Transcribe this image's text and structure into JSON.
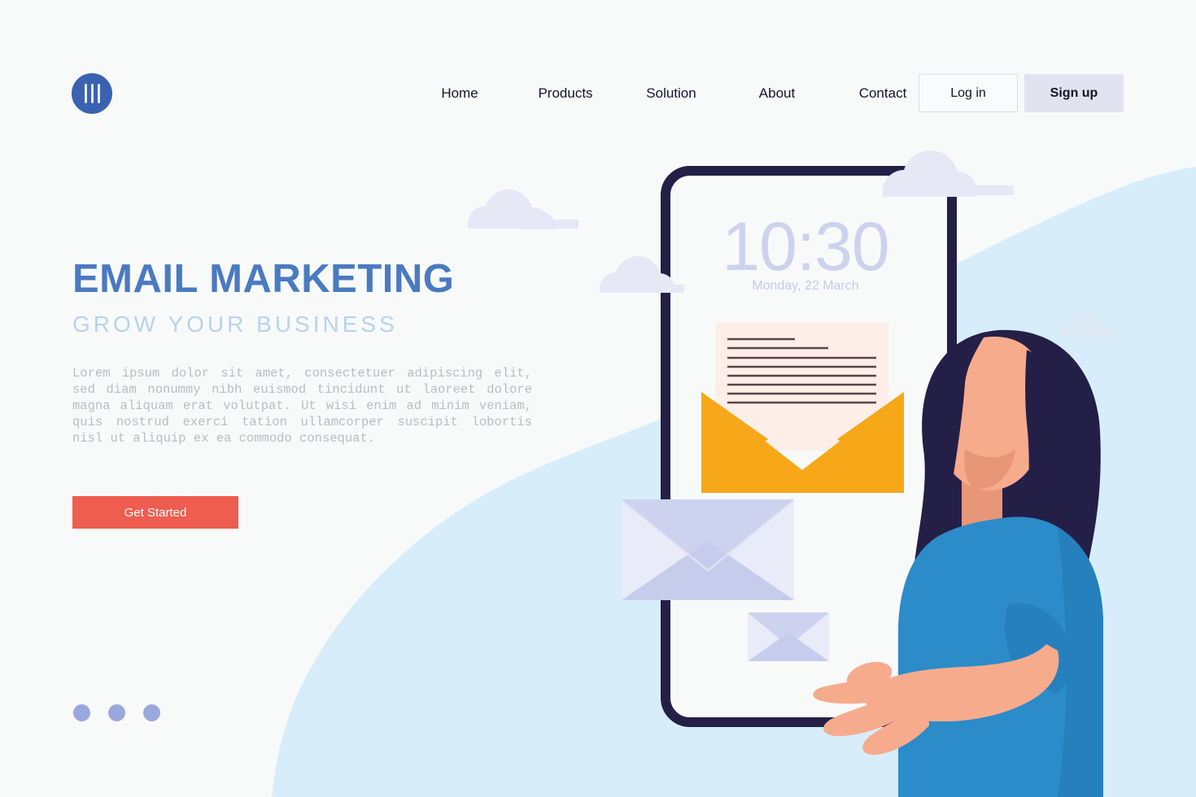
{
  "brand": {
    "logo_icon": "three-bars-circle-logo"
  },
  "nav": {
    "items": [
      {
        "label": "Home"
      },
      {
        "label": "Products"
      },
      {
        "label": "Solution"
      },
      {
        "label": "About"
      },
      {
        "label": "Contact"
      }
    ],
    "login_label": "Log in",
    "signup_label": "Sign up"
  },
  "hero": {
    "title": "EMAIL MARKETING",
    "subtitle": "GROW YOUR BUSINESS",
    "body": "Lorem ipsum dolor sit amet, consectetuer adipiscing elit, sed diam nonummy nibh euismod tincidunt ut laoreet dolore magna aliquam erat volutpat. Ut wisi enim ad minim veniam, quis nostrud exerci tation ullamcorper suscipit lobortis nisl ut aliquip ex ea commodo consequat.",
    "cta_label": "Get Started",
    "carousel_dots": 3
  },
  "phone": {
    "time": "10:30",
    "date": "Monday, 22 March"
  },
  "illustration": {
    "envelope_large_icon": "open-envelope-icon",
    "envelope_medium_icon": "closed-envelope-icon",
    "envelope_small_icon": "closed-envelope-icon",
    "clouds": 4,
    "character": "woman-pointing-illustration"
  },
  "colors": {
    "page_bg": "#f8fafa",
    "blob": "#d7eefa",
    "brand_blue": "#4a7ac0",
    "subtitle_blue": "#b9d2ec",
    "cta_red": "#ee5d4f",
    "signup_bg": "#e2e3f0",
    "phone_frame": "#241f47",
    "envelope_orange": "#f6a819",
    "letter_cream": "#fdeee8",
    "envelope_lilac": "#dde0f3",
    "hair_navy": "#241f47",
    "skin": "#f7ab8d",
    "shirt_blue": "#2c8bc9",
    "cloud": "#e6e8f6",
    "dot_blue": "#9aa8de"
  }
}
